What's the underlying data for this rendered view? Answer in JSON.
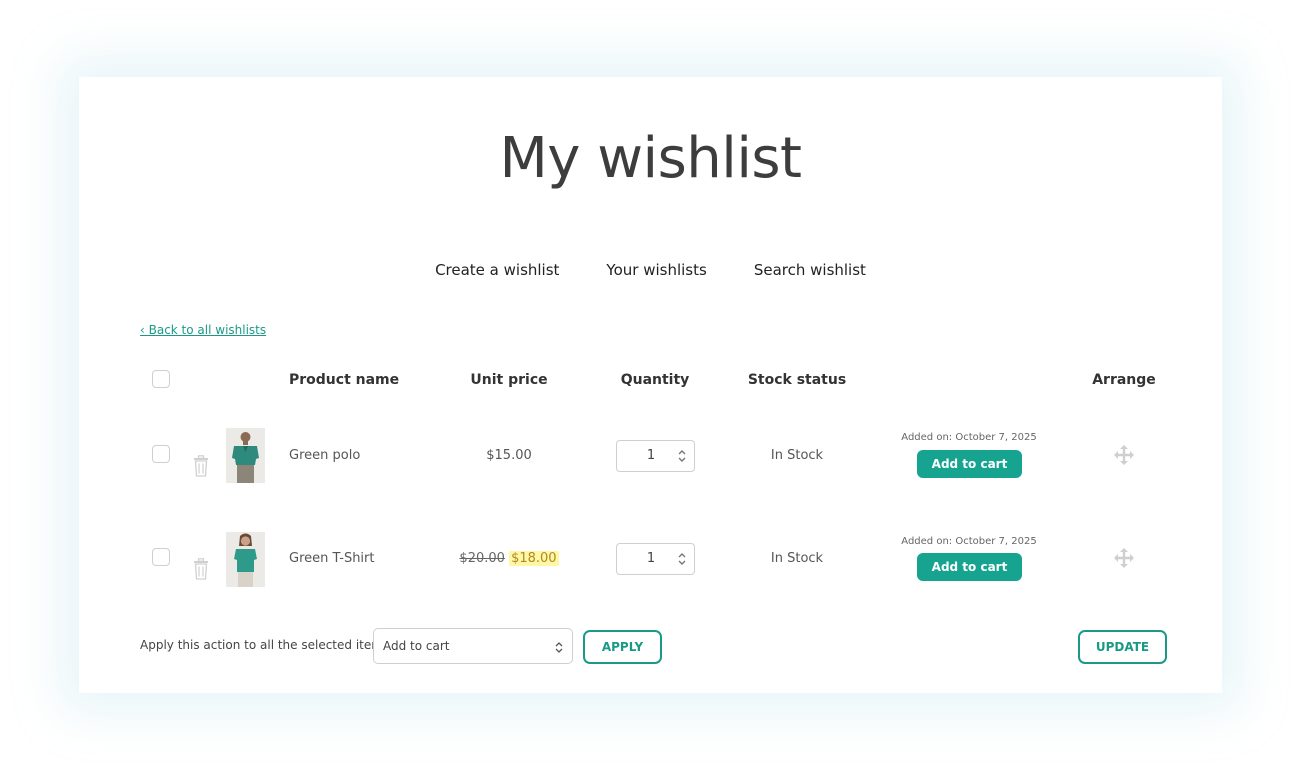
{
  "page": {
    "title": "My wishlist"
  },
  "nav": {
    "items": [
      "Create a wishlist",
      "Your wishlists",
      "Search wishlist"
    ]
  },
  "back_link": "‹ Back to all wishlists",
  "table": {
    "headers": {
      "product_name": "Product name",
      "unit_price": "Unit price",
      "quantity": "Quantity",
      "stock_status": "Stock status",
      "arrange": "Arrange"
    },
    "rows": [
      {
        "name": "Green polo",
        "price": "$15.00",
        "old_price": "",
        "quantity": "1",
        "stock": "In Stock",
        "added": "Added on: October 7, 2025",
        "cart_label": "Add to cart"
      },
      {
        "name": "Green T-Shirt",
        "price": "$18.00",
        "old_price": "$20.00",
        "quantity": "1",
        "stock": "In Stock",
        "added": "Added on: October 7, 2025",
        "cart_label": "Add to cart"
      }
    ]
  },
  "footer": {
    "apply_label": "Apply this action to all the selected items:",
    "action_select": "Add to cart",
    "apply_button": "APPLY",
    "update_button": "UPDATE"
  },
  "icons": {
    "trash": "trash-icon",
    "move": "move-icon",
    "stepper": "stepper-arrows-icon"
  },
  "colors": {
    "accent": "#16a390",
    "highlight": "#fff7a8"
  }
}
